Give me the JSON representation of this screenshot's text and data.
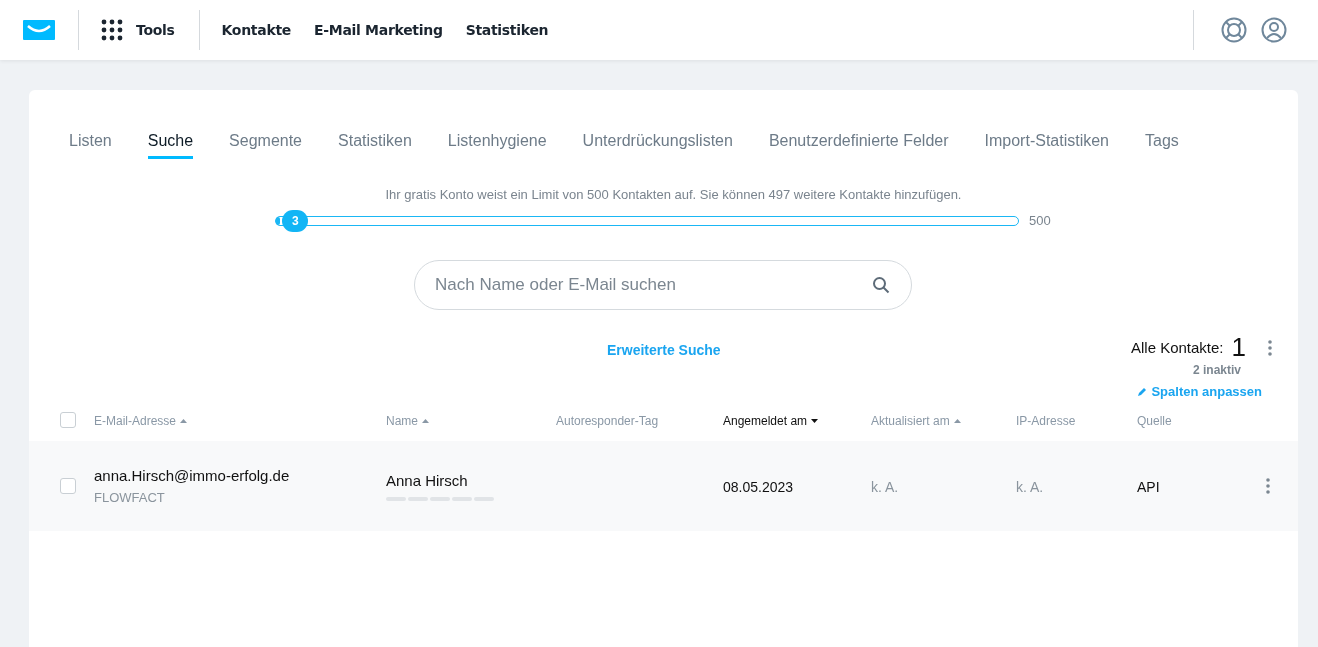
{
  "topbar": {
    "tools_label": "Tools",
    "nav": [
      {
        "label": "Kontakte"
      },
      {
        "label": "E-Mail Marketing"
      },
      {
        "label": "Statistiken"
      }
    ]
  },
  "tabs": [
    {
      "label": "Listen",
      "selected": false
    },
    {
      "label": "Suche",
      "selected": true
    },
    {
      "label": "Segmente",
      "selected": false
    },
    {
      "label": "Statistiken",
      "selected": false
    },
    {
      "label": "Listenhygiene",
      "selected": false
    },
    {
      "label": "Unterdrückungslisten",
      "selected": false
    },
    {
      "label": "Benutzerdefinierte Felder",
      "selected": false
    },
    {
      "label": "Import-Statistiken",
      "selected": false
    },
    {
      "label": "Tags",
      "selected": false
    }
  ],
  "limit": {
    "message": "Ihr gratis Konto weist ein Limit von 500 Kontakten auf. Sie können 497 weitere Kontakte hinzufügen.",
    "value": "3",
    "max": "500",
    "level": 0.006
  },
  "search": {
    "placeholder": "Nach Name oder E-Mail suchen"
  },
  "advanced_search": "Erweiterte Suche",
  "summary": {
    "label": "Alle Kontakte:",
    "count": "1",
    "inactive": "2 inaktiv",
    "customize": "Spalten anpassen"
  },
  "table": {
    "select_all_checked": false,
    "columns": [
      {
        "label": "E-Mail-Adresse",
        "sorted": true,
        "descending": false,
        "active": false
      },
      {
        "label": "Name",
        "sorted": true,
        "descending": false,
        "active": false
      },
      {
        "label": "Autoresponder-Tag",
        "sorted": false,
        "active": false
      },
      {
        "label": "Angemeldet am",
        "sorted": true,
        "descending": true,
        "active": true
      },
      {
        "label": "Aktualisiert am",
        "sorted": true,
        "descending": false,
        "active": false
      },
      {
        "label": "IP-Adresse",
        "sorted": false,
        "active": false
      },
      {
        "label": "Quelle",
        "sorted": false,
        "active": false
      }
    ],
    "rows": [
      {
        "checked": false,
        "cells": [
          {
            "kind": "email",
            "text": "anna.Hirsch@immo-erfolg.de",
            "sub": "FLOWFACT"
          },
          {
            "kind": "name",
            "text": "Anna Hirsch"
          },
          {
            "kind": "blank"
          },
          {
            "kind": "text",
            "text": "08.05.2023",
            "muted": false
          },
          {
            "kind": "text",
            "text": "k. A.",
            "muted": true
          },
          {
            "kind": "text",
            "text": "k. A.",
            "muted": true
          },
          {
            "kind": "text",
            "text": "API",
            "muted": false
          }
        ]
      }
    ]
  }
}
